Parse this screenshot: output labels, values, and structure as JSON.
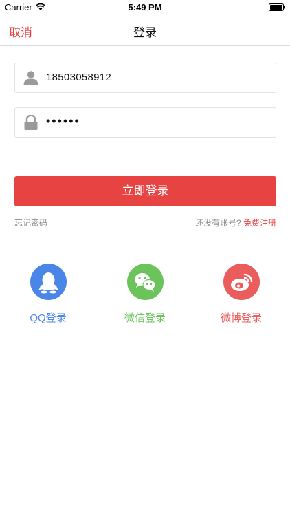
{
  "status_bar": {
    "carrier": "Carrier",
    "time": "5:49 PM"
  },
  "nav": {
    "cancel_label": "取消",
    "title": "登录"
  },
  "form": {
    "username_value": "18503058912",
    "password_value": "••••••",
    "submit_label": "立即登录",
    "forgot_label": "忘记密码",
    "register_prompt": "还没有账号?",
    "register_link": "免费注册"
  },
  "social_login": [
    {
      "label": "QQ登录",
      "icon": "qq-icon",
      "color": "#4a86e8"
    },
    {
      "label": "微信登录",
      "icon": "wechat-icon",
      "color": "#6cc35b"
    },
    {
      "label": "微博登录",
      "icon": "weibo-icon",
      "color": "#eb5c5c"
    }
  ],
  "colors": {
    "accent": "#e84343"
  }
}
